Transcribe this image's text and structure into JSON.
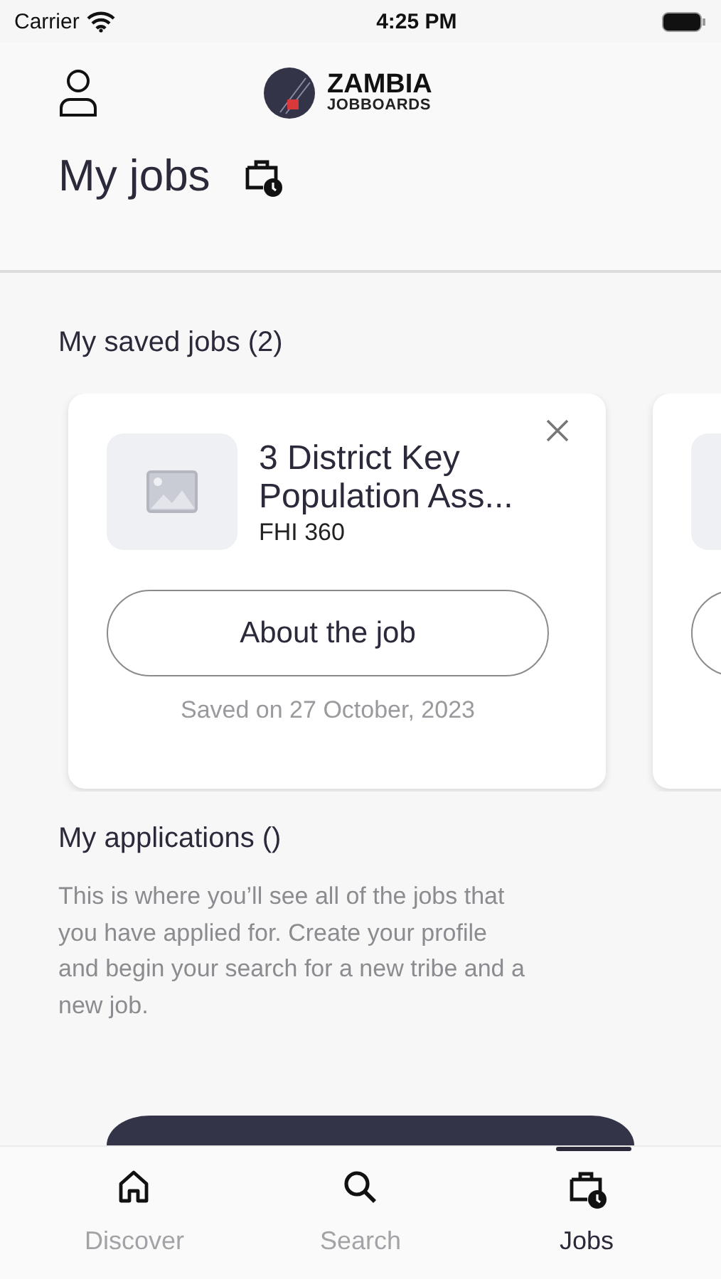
{
  "status_bar": {
    "carrier": "Carrier",
    "time": "4:25 PM"
  },
  "header": {
    "brand": "ZAMBIA",
    "brand_sub": "JOBBOARDS"
  },
  "page_title": "My jobs",
  "saved_jobs": {
    "title": "My saved jobs (2)",
    "items": [
      {
        "kind": "full",
        "title": "3 District Key Population Ass...",
        "company": "FHI 360",
        "button": "About the job",
        "saved": "Saved on 27 October, 2023"
      },
      {
        "kind": "peek"
      }
    ]
  },
  "applications": {
    "title": "My applications ()",
    "text": "This is where you’ll see all of the jobs that you have applied for. Create your profile and begin your search for a new tribe and a new job.",
    "action": {
      "kind": "filled"
    }
  },
  "tabs": [
    {
      "label": "Discover",
      "kind": "home",
      "selected": false
    },
    {
      "label": "Search",
      "kind": "search",
      "selected": false
    },
    {
      "label": "Jobs",
      "kind": "briefcase",
      "selected": true
    }
  ]
}
